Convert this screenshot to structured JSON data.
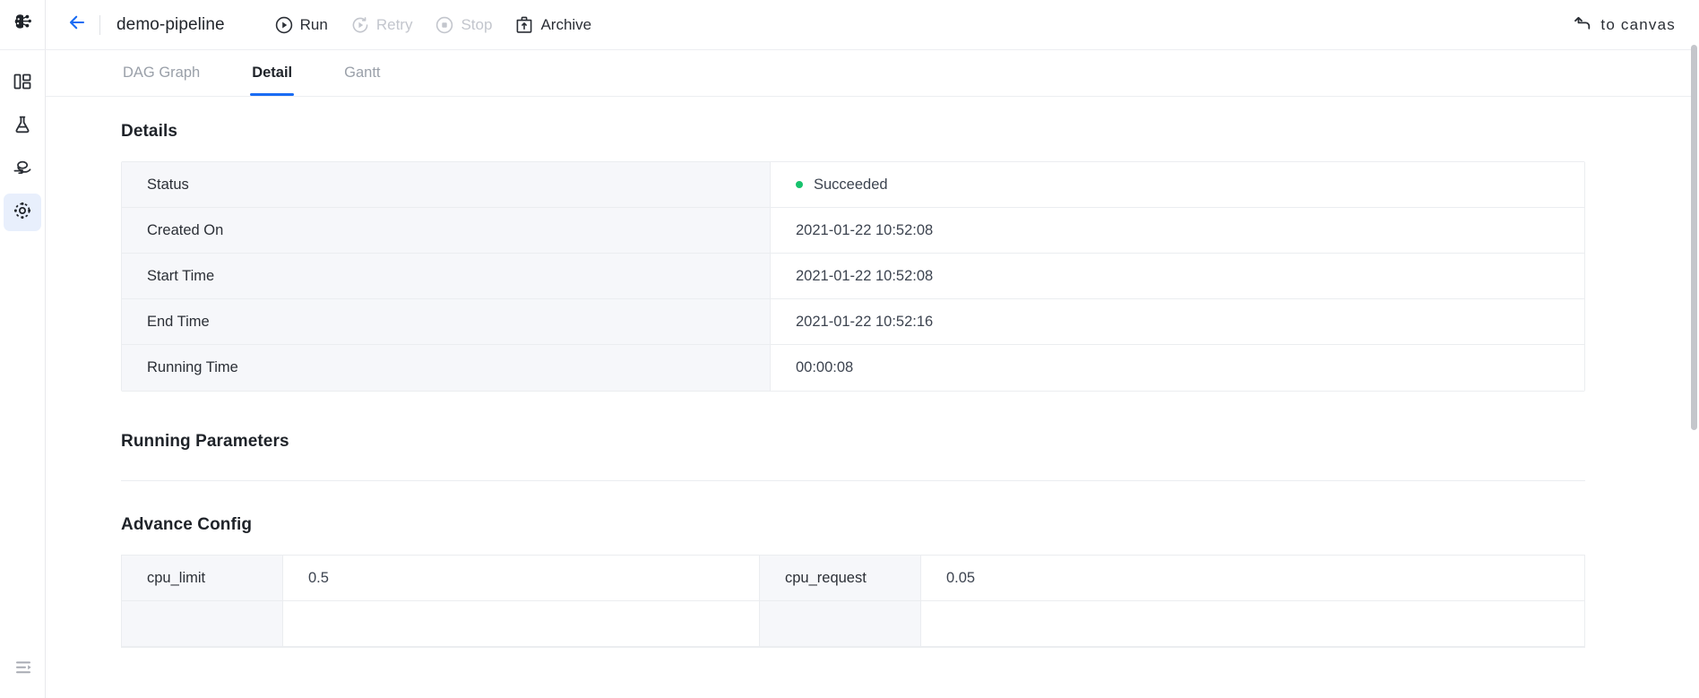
{
  "sidebar": {
    "logo": {
      "icon": "brain-ai-logo-icon"
    },
    "items": [
      {
        "icon": "dashboard-layout-icon",
        "name": "dashboard",
        "active": false
      },
      {
        "icon": "flask-experiment-icon",
        "name": "experiment",
        "active": false
      },
      {
        "icon": "serving-hand-icon",
        "name": "serving",
        "active": false
      },
      {
        "icon": "pipeline-gear-icon",
        "name": "pipeline",
        "active": true
      }
    ],
    "bottom": {
      "icon": "collapse-sidebar-icon",
      "name": "collapse-sidebar"
    }
  },
  "header": {
    "back_icon": "arrow-left-icon",
    "title": "demo-pipeline",
    "actions": [
      {
        "label": "Run",
        "icon": "play-circle-icon",
        "disabled": false
      },
      {
        "label": "Retry",
        "icon": "retry-circle-icon",
        "disabled": true
      },
      {
        "label": "Stop",
        "icon": "stop-circle-icon",
        "disabled": true
      },
      {
        "label": "Archive",
        "icon": "archive-box-icon",
        "disabled": false
      }
    ],
    "to_canvas": {
      "label": "to  canvas",
      "icon": "undo-arrow-icon"
    }
  },
  "tabs": [
    {
      "label": "DAG Graph",
      "active": false
    },
    {
      "label": "Detail",
      "active": true
    },
    {
      "label": "Gantt",
      "active": false
    }
  ],
  "details": {
    "title": "Details",
    "rows": [
      {
        "label": "Status",
        "value": "Succeeded",
        "status": true,
        "status_color": "#17c26d"
      },
      {
        "label": "Created On",
        "value": "2021-01-22 10:52:08",
        "status": false
      },
      {
        "label": "Start Time",
        "value": "2021-01-22 10:52:08",
        "status": false
      },
      {
        "label": "End Time",
        "value": "2021-01-22 10:52:16",
        "status": false
      },
      {
        "label": "Running Time",
        "value": "00:00:08",
        "status": false
      }
    ]
  },
  "running_parameters": {
    "title": "Running Parameters",
    "rows": []
  },
  "advance_config": {
    "title": "Advance Config",
    "rows": [
      {
        "key1": "cpu_limit",
        "val1": "0.5",
        "key2": "cpu_request",
        "val2": "0.05"
      }
    ]
  },
  "colors": {
    "accent": "#1a6cf3",
    "success": "#17c26d",
    "label_bg": "#f6f7fa",
    "border": "#ebedf0",
    "text": "#1f2329",
    "muted": "#9aa0a9"
  }
}
